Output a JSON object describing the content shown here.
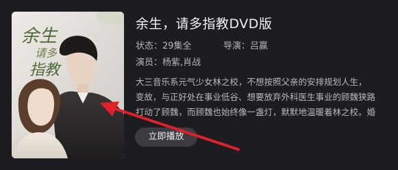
{
  "title": "余生，请多指教DVD版",
  "meta": {
    "status": "状态：29集全",
    "director": "导演：吕赢",
    "cast": "演员：杨紫,肖战"
  },
  "description_lines": [
    "大三音乐系元气少女林之校，不想按照父亲的安排规划人生，",
    "变故，与正好处在事业低谷、想要放弃外科医生事业的顾魏狭路",
    "打动了顾魏，而顾魏也始终像一盏灯，默默地温暖着林之校。婚"
  ],
  "play_button": "立即播放",
  "poster": {
    "calligraphy_title": "余生请多指教"
  },
  "colors": {
    "background": "#1d1d21",
    "button": "#3b3b41",
    "arrow": "#e0202a"
  }
}
